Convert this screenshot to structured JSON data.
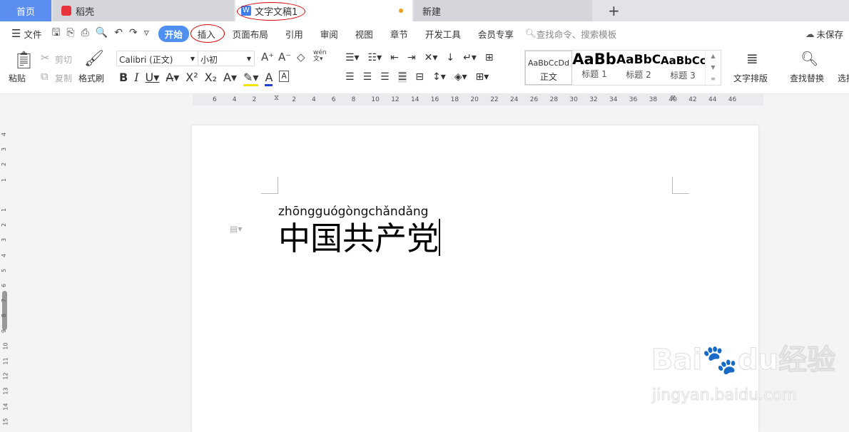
{
  "tabs": [
    {
      "label": "首页",
      "color": "#5b8ef0"
    },
    {
      "label": "稻壳"
    },
    {
      "label": "文字文稿1",
      "active": true,
      "unsaved_dot_color": "#f0a020"
    },
    {
      "label": "新建"
    }
  ],
  "new_tab": "+",
  "menu": {
    "file": "文件",
    "items": [
      "开始",
      "插入",
      "页面布局",
      "引用",
      "审阅",
      "视图",
      "章节",
      "开发工具",
      "会员专享"
    ],
    "active": "开始",
    "search_placeholder": "查找命令、搜索模板",
    "save_status": "未保存"
  },
  "ribbon": {
    "paste": "粘贴",
    "cut": "剪切",
    "copy": "复制",
    "format_painter": "格式刷",
    "font_name": "Calibri (正文)",
    "font_size": "小初",
    "phonetic": "wén",
    "styles": [
      {
        "preview": "AaBbCcDd",
        "label": "正文"
      },
      {
        "preview": "AaBb",
        "label": "标题 1"
      },
      {
        "preview": "AaBbC",
        "label": "标题 2"
      },
      {
        "preview": "AaBbCc",
        "label": "标题 3"
      }
    ],
    "text_layout": "文字排版",
    "find_replace": "查找替换",
    "select": "选择"
  },
  "ruler": {
    "ticks": [
      "6",
      "4",
      "2",
      "",
      "2",
      "4",
      "6",
      "8",
      "10",
      "12",
      "14",
      "16",
      "18",
      "20",
      "22",
      "24",
      "26",
      "28",
      "30",
      "32",
      "34",
      "36",
      "38",
      "40",
      "42",
      "44",
      "46"
    ],
    "vticks": [
      "4",
      "3",
      "2",
      "1",
      "",
      "1",
      "2",
      "3",
      "4",
      "5",
      "6",
      "7",
      "8",
      "9",
      "10",
      "11",
      "12",
      "13",
      "14",
      "15"
    ]
  },
  "document": {
    "pinyin": "zhōngguógòngchǎndǎng",
    "text": "中国共产党"
  },
  "watermark": {
    "brand": "Baidu经验",
    "url": "jingyan.baidu.com"
  }
}
